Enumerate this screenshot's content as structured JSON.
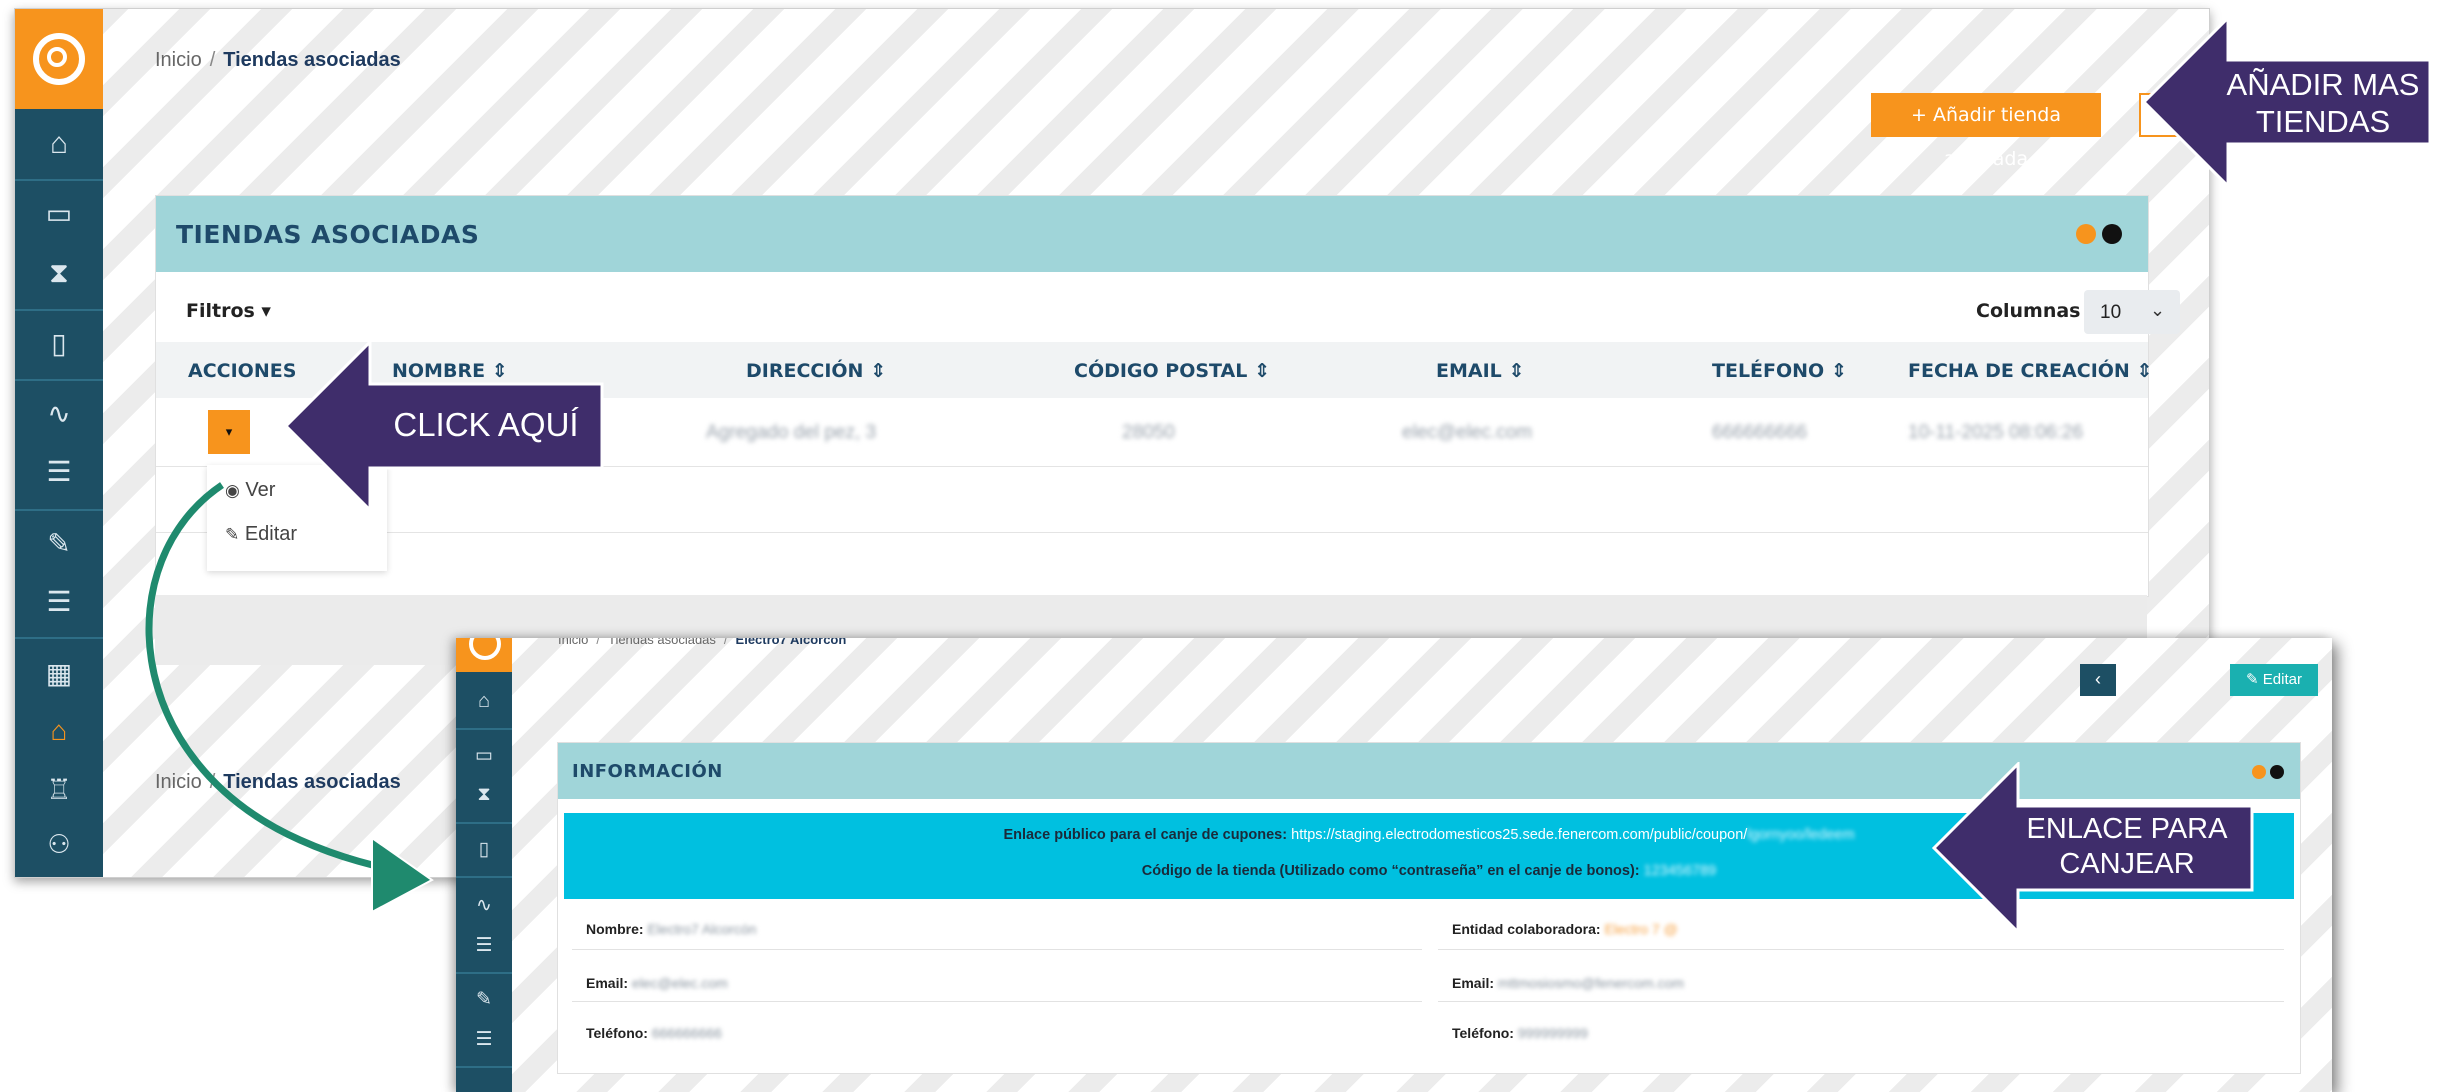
{
  "main": {
    "breadcrumb": {
      "home": "Inicio",
      "separator": "/",
      "current": "Tiendas asociadas"
    },
    "add_button": "+ Añadir tienda asociada",
    "panel_title": "TIENDAS ASOCIADAS",
    "filters_label": "Filtros ▾",
    "columns_label": "Columnas",
    "page_size": "10",
    "headers": [
      "ACCIONES",
      "NOMBRE ⇕",
      "DIRECCIÓN ⇕",
      "CÓDIGO POSTAL ⇕",
      "EMAIL ⇕",
      "TELÉFONO ⇕",
      "FECHA DE CREACIÓN ⇕"
    ],
    "row": {
      "address": "Agregado del pez, 3",
      "postal_code": "28050",
      "email": "elec@elec.com",
      "phone": "666666666",
      "created": "10-11-2025 08:06:26"
    },
    "menu": {
      "view": "Ver",
      "edit": "Editar"
    },
    "bottom_breadcrumb": {
      "home": "Inicio",
      "separator": "/",
      "current": "Tiendas asociadas"
    }
  },
  "detail": {
    "breadcrumb": {
      "home": "Inicio",
      "mid": "Tiendas asociadas",
      "current": "Electro7 Alcorcón",
      "separator": "/"
    },
    "back_label": "‹",
    "edit_label": "Editar",
    "panel_title": "INFORMACIÓN",
    "link_label": "Enlace público para el canje de cupones:",
    "link_url": "https://staging.electrodomesticos25.sede.fenercom.com/public/coupon/",
    "link_token": "lgornyoo/ledeem",
    "code_label": "Código de la tienda (Utilizado como “contraseña” en el canje de bonos):",
    "code_value": "123456789",
    "fields_left": [
      {
        "label": "Nombre:",
        "value": "Electro7 Alcorcón"
      },
      {
        "label": "Email:",
        "value": "elec@elec.com"
      },
      {
        "label": "Teléfono:",
        "value": "666666666"
      }
    ],
    "fields_right": [
      {
        "label": "Entidad colaboradora:",
        "value": "Electro 7 @"
      },
      {
        "label": "Email:",
        "value": "mttmosiosmo@fenercom.com"
      },
      {
        "label": "Teléfono:",
        "value": "999999999"
      }
    ]
  },
  "callouts": {
    "click": "CLICK AQUÍ",
    "add_more_line1": "AÑADIR MAS",
    "add_more_line2": "TIENDAS",
    "link_line1": "ENLACE PARA",
    "link_line2": "CANJEAR"
  },
  "colors": {
    "accent_orange": "#f7941d",
    "sidebar": "#1d4f64",
    "panel_header": "#a0d5d9",
    "callout_purple": "#3f2d6b",
    "link_banner": "#00c0e0",
    "teal_button": "#1ab0b0",
    "connector_green": "#1f8a6e"
  }
}
